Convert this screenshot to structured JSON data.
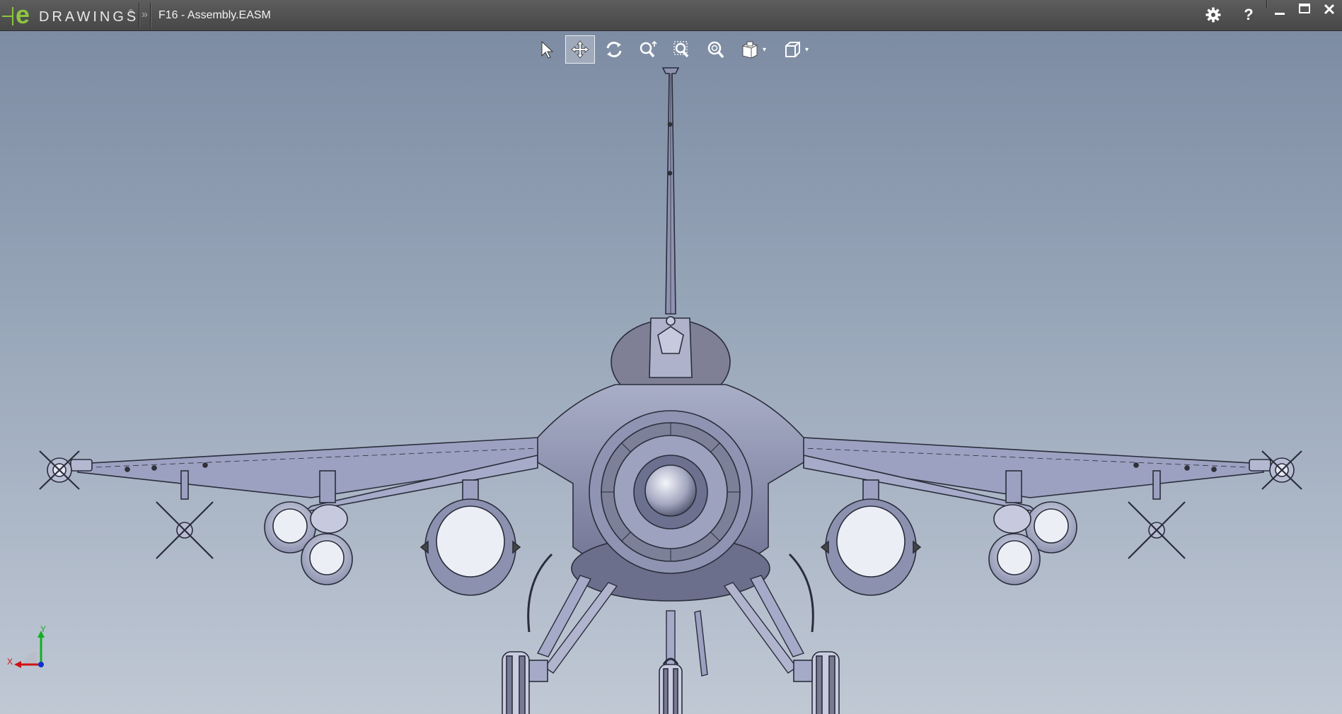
{
  "app": {
    "logo_e": "e",
    "logo_text": "DRAWINGS",
    "logo_reg": "®",
    "breadcrumb_chevron": "»",
    "document_title": "F16 - Assembly.EASM"
  },
  "title_controls": {
    "settings_icon": "gear-icon",
    "help_label": "?",
    "minimize_icon": "minimize-icon",
    "maximize_icon": "maximize-icon",
    "close_icon": "close-icon"
  },
  "toolbar": {
    "tools": [
      {
        "name": "select",
        "icon": "arrow-pointer-icon",
        "active": false
      },
      {
        "name": "pan",
        "icon": "pan-arrows-icon",
        "active": true
      },
      {
        "name": "rotate",
        "icon": "rotate-icon",
        "active": false
      },
      {
        "name": "zoom",
        "icon": "zoom-icon",
        "active": false
      },
      {
        "name": "zoom-to-fit",
        "icon": "zoom-fit-icon",
        "active": false
      },
      {
        "name": "zoom-to-area",
        "icon": "zoom-area-icon",
        "active": false
      },
      {
        "name": "view-orientation",
        "icon": "view-orientation-icon",
        "active": false,
        "has_dropdown": true
      },
      {
        "name": "display-style",
        "icon": "cube-icon",
        "active": false,
        "has_dropdown": true
      }
    ]
  },
  "triad": {
    "x_label": "X",
    "y_label": "Y",
    "colors": {
      "x": "#d01010",
      "y": "#10b020",
      "z": "#1030d0"
    }
  },
  "colors": {
    "brand_green": "#8cc63f",
    "titlebar": "#4f4f4f",
    "model_fill": "#9ea3c2",
    "model_line": "#2a2d3a"
  }
}
